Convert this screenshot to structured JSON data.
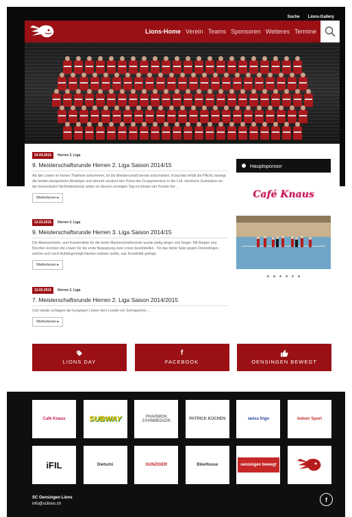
{
  "header": {
    "utility_links": [
      "Suche",
      "Lions-Gallery"
    ],
    "menu": [
      {
        "label": "Lions-Home",
        "active": true
      },
      {
        "label": "Verein",
        "active": false
      },
      {
        "label": "Teams",
        "active": false
      },
      {
        "label": "Sponsoren",
        "active": false
      },
      {
        "label": "Weiteres",
        "active": false
      },
      {
        "label": "Termine",
        "active": false
      }
    ],
    "search_icon": "search-icon",
    "logo_icon": "lion-head-icon"
  },
  "articles": [
    {
      "date": "24.04.2015",
      "category": "Herren 3. Liga",
      "title": "9. Meisterschaftsrunde Herren 2. Liga Saison 2014/15",
      "text": "Als die Löwen im fernen Thalheim ankommen, ist die Meisterschaft bereits entschieden. Krauchtal erfüllt die Pflicht, besiegt die beiden designierten Absteiger und stemmt verdient den Pokal des Gruppenersten in die Luft. Herzliche Gratulation an die Emmentaler! Nichtsdestotrotz sollen an diesem sonnigen Tag nochmals vier Punkte her…",
      "more": "Weiterlesen"
    },
    {
      "date": "13.03.2015",
      "category": "Herren 3. Liga",
      "title": "9. Meisterschaftsrunde Herren 3. Liga Saison 2014/15",
      "text": "Die Abwesenheits- und Krankenliste für die letzte Meisterschaftsrunde wurde stetig länger und länger. Mit Biegen und Brechen konnten die Löwen für die erste Begegnung zwei Linien bereitstellen - für das letzte Spiel gegen Derendingen, welche sich noch Aufstiegsmöglichkeiten wahren wollte, war Kreativität gefragt.",
      "more": "Weiterlesen"
    },
    {
      "date": "13.02.2015",
      "category": "Herren 2. Liga",
      "title": "7. Meisterschaftsrunde Herren 2. Liga Saison 2014/2015",
      "text": "Und wieder schlagen die hungrigen Löwen dem Leader ein Schnippchen …",
      "more": "Weiterlesen"
    }
  ],
  "sidebar": {
    "heading": "Hauptsponsor",
    "sponsor_name": "Café Knaus",
    "carousel_dots": 6,
    "carousel_active": 4
  },
  "cta": [
    {
      "label": "LIONS DAY",
      "icon": "tag-icon"
    },
    {
      "label": "FACEBOOK",
      "icon": "facebook-icon"
    },
    {
      "label": "OENSINGEN BEWEGT",
      "icon": "thumbs-up-icon"
    }
  ],
  "footer": {
    "sponsors": [
      {
        "name": "Café Knaus",
        "color": "#c2185b"
      },
      {
        "name": "SUBWAY",
        "color": "#1b8a3a"
      },
      {
        "name": "PHARMON ZAHNMEDIZIN",
        "color": "#777777"
      },
      {
        "name": "PATRICK KÜCHEN",
        "color": "#555555"
      },
      {
        "name": "swiss frigo",
        "color": "#1f3f9a"
      },
      {
        "name": "Indoor Sport",
        "color": "#c62828"
      },
      {
        "name": "iFIL",
        "color": "#111111"
      },
      {
        "name": "Dietschi",
        "color": "#333333"
      },
      {
        "name": "GUNZIGER",
        "color": "#b71c1c"
      },
      {
        "name": "BikeHouse",
        "color": "#333333"
      },
      {
        "name": "oensingen bewegt",
        "color": "#c62828"
      },
      {
        "name": "",
        "color": "#b71c1c"
      }
    ],
    "club_name": "SC Oensingen Lions",
    "email": "info@sclions.ch",
    "social_icon": "facebook-icon",
    "social_glyph": "f"
  },
  "colors": {
    "brand": "#9a1014",
    "dark": "#0a0a0a"
  }
}
